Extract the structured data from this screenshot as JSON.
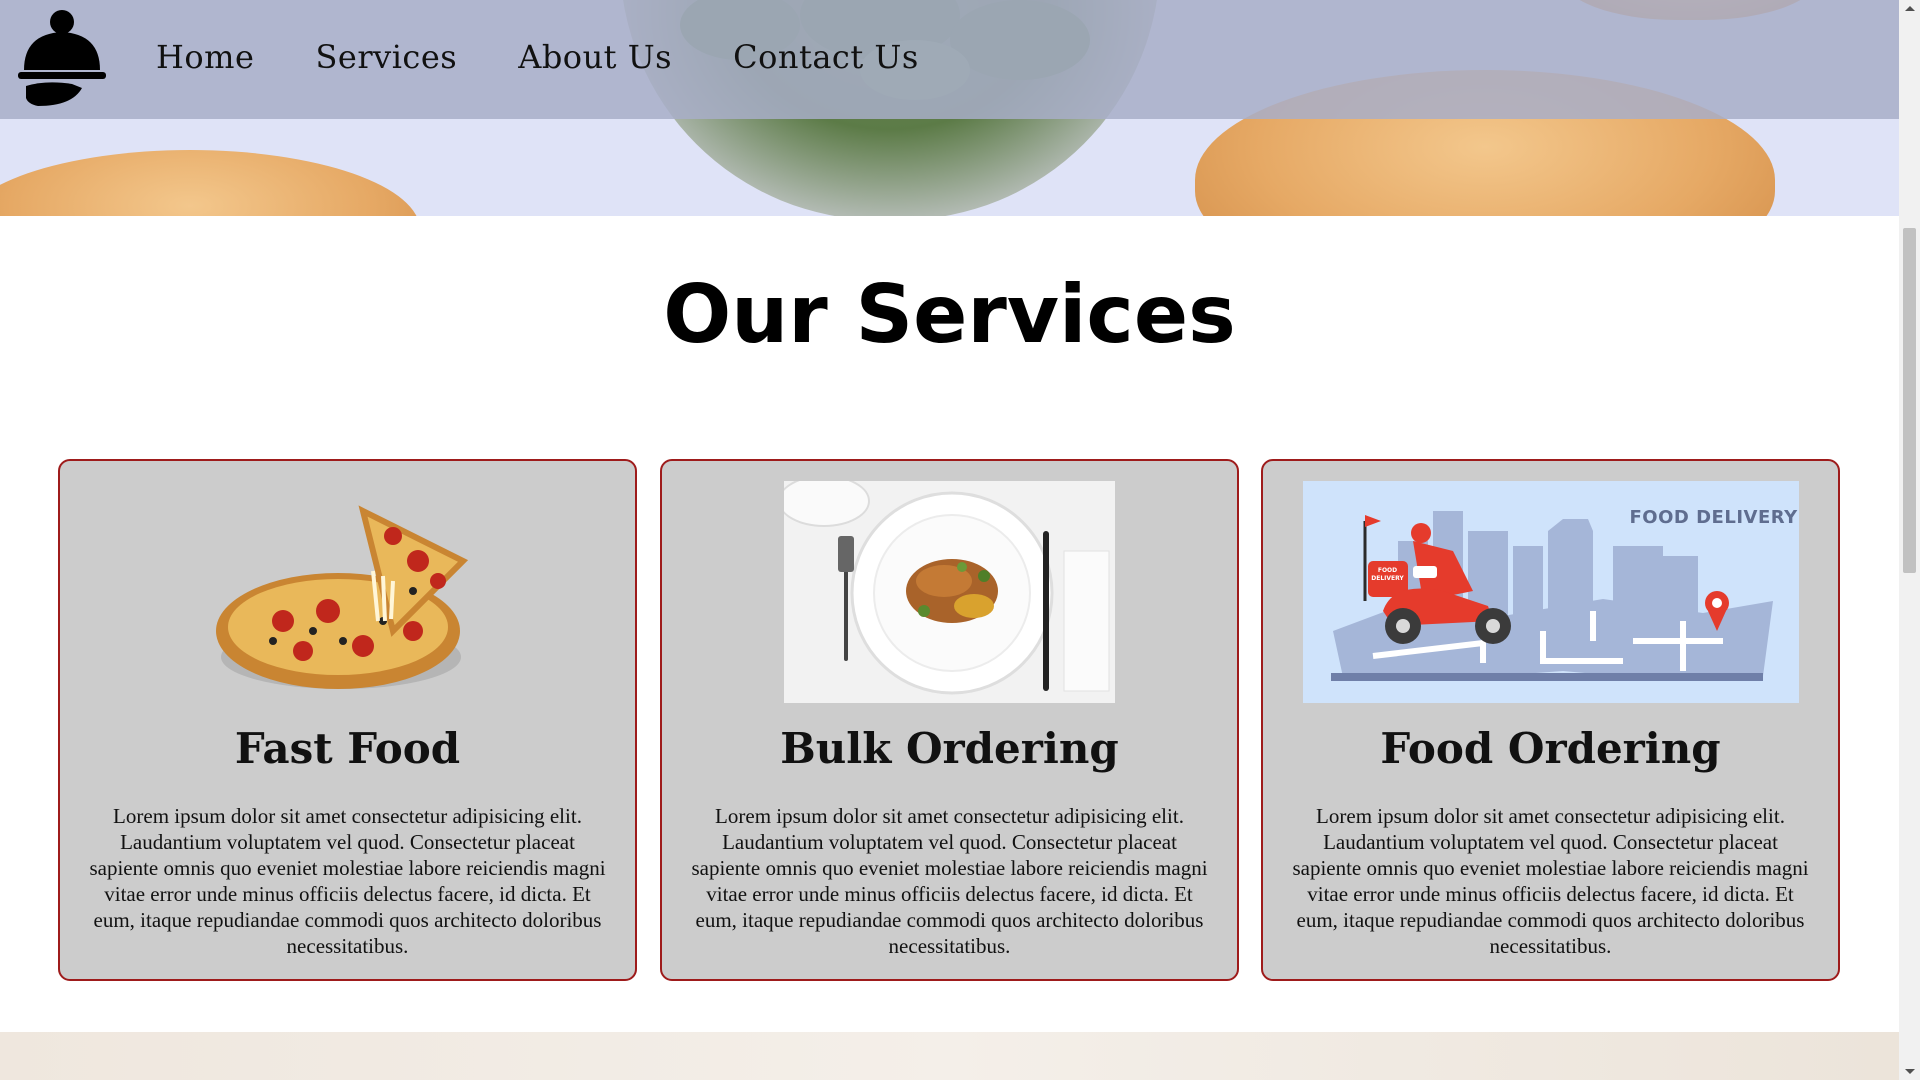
{
  "nav": {
    "logo_icon": "serving-cloche-icon",
    "links": [
      {
        "label": "Home"
      },
      {
        "label": "Services"
      },
      {
        "label": "About Us"
      },
      {
        "label": "Contact Us"
      }
    ]
  },
  "services": {
    "title": "Our Services",
    "cards": [
      {
        "title": "Fast Food",
        "image": "pizza-image",
        "text": "Lorem ipsum dolor sit amet consectetur adipisicing elit. Laudantium voluptatem vel quod. Consectetur placeat sapiente omnis quo eveniet molestiae labore reiciendis magni vitae error unde minus officiis delectus facere, id dicta. Et eum, itaque repudiandae commodi quos architecto doloribus necessitatibus."
      },
      {
        "title": "Bulk Ordering",
        "image": "plated-dish-image",
        "text": "Lorem ipsum dolor sit amet consectetur adipisicing elit. Laudantium voluptatem vel quod. Consectetur placeat sapiente omnis quo eveniet molestiae labore reiciendis magni vitae error unde minus officiis delectus facere, id dicta. Et eum, itaque repudiandae commodi quos architecto doloribus necessitatibus."
      },
      {
        "title": "Food Ordering",
        "image": "food-delivery-illustration",
        "image_caption": "FOOD DELIVERY",
        "box_label": "FOOD DELIVERY",
        "text": "Lorem ipsum dolor sit amet consectetur adipisicing elit. Laudantium voluptatem vel quod. Consectetur placeat sapiente omnis quo eveniet molestiae labore reiciendis magni vitae error unde minus officiis delectus facere, id dicta. Et eum, itaque repudiandae commodi quos architecto doloribus necessitatibus."
      }
    ]
  },
  "colors": {
    "card_background": "#cccccc",
    "card_border": "#9e1b1b",
    "nav_background": "#a8aec8"
  }
}
